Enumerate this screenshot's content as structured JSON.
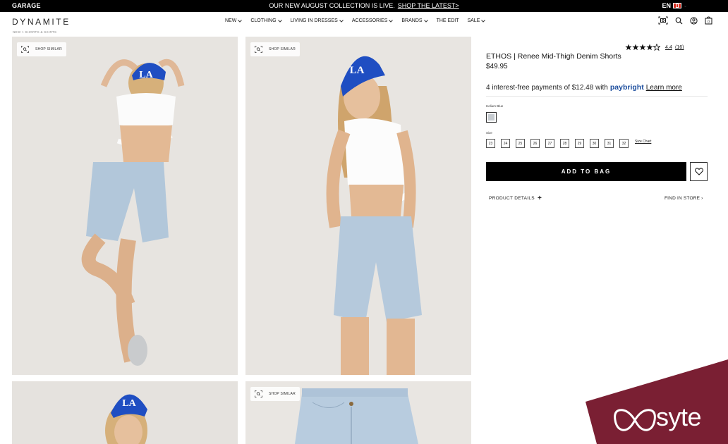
{
  "topbar": {
    "brand": "GARAGE",
    "promo_text": "OUR NEW AUGUST COLLECTION IS LIVE.",
    "promo_link": "SHOP THE LATEST>",
    "lang": "EN"
  },
  "header": {
    "logo": "DYNAMITE",
    "breadcrumb": "NEW > SHORTS & SKIRTS",
    "nav": [
      {
        "label": "NEW"
      },
      {
        "label": "CLOTHING"
      },
      {
        "label": "LIVING IN DRESSES"
      },
      {
        "label": "ACCESSORIES"
      },
      {
        "label": "BRANDS"
      },
      {
        "label": "THE EDIT"
      },
      {
        "label": "SALE"
      }
    ],
    "cart_count": "0"
  },
  "gallery": {
    "shop_similar_label": "SHOP SIMILAR"
  },
  "product": {
    "rating": "4.4",
    "rating_count": "(16)",
    "rating_stars": 4.4,
    "title": "ETHOS | Renee Mid-Thigh Denim Shorts",
    "price": "$49.95",
    "installments_text": "4 interest-free payments of $12.48 with",
    "paybright": "paybright",
    "learn_more": "Learn more",
    "color_label": "Helium Blue",
    "swatch_color": "#c6cbd0",
    "size_label": "Size",
    "sizes": [
      "23",
      "24",
      "25",
      "26",
      "27",
      "28",
      "29",
      "30",
      "31",
      "32"
    ],
    "size_chart": "Size Chart",
    "add_to_bag": "ADD TO BAG",
    "product_details": "PRODUCT DETAILS",
    "find_in_store": "FIND IN STORE"
  },
  "overlay": {
    "brand": "syte",
    "color": "#7a1f33"
  }
}
